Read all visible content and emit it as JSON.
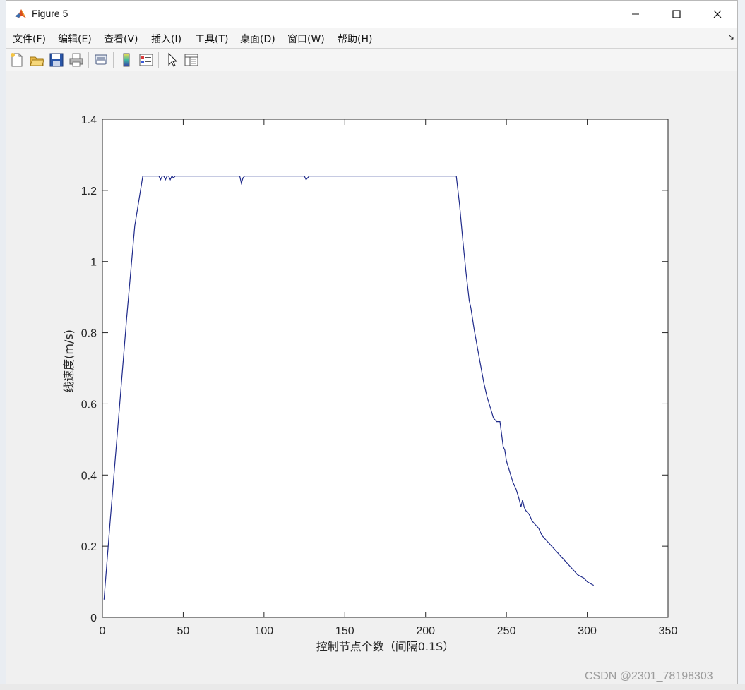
{
  "window": {
    "title": "Figure 5",
    "min_symbol": "—",
    "max_symbol": "☐",
    "close_symbol": "✕"
  },
  "menu": {
    "items": [
      "文件(F)",
      "编辑(E)",
      "查看(V)",
      "插入(I)",
      "工具(T)",
      "桌面(D)",
      "窗口(W)",
      "帮助(H)"
    ],
    "dock_arrow": "↘"
  },
  "toolbar": {
    "icons": [
      "new-figure-icon",
      "open-file-icon",
      "save-icon",
      "print-icon",
      "print-preview-icon",
      "colorbar-icon",
      "legend-icon",
      "pointer-icon",
      "property-editor-icon"
    ]
  },
  "watermark": "CSDN @2301_78198303",
  "colors": {
    "line": "#1f2a8a",
    "axes_bg": "#ffffff",
    "figure_bg": "#f0f0f0"
  },
  "chart_data": {
    "type": "line",
    "xlabel": "控制节点个数（间隔0.1S）",
    "ylabel": "线速度(m/s)",
    "xlim": [
      0,
      350
    ],
    "ylim": [
      0,
      1.4
    ],
    "xticks": [
      0,
      50,
      100,
      150,
      200,
      250,
      300,
      350
    ],
    "yticks": [
      0,
      0.2,
      0.4,
      0.6,
      0.8,
      1,
      1.2,
      1.4
    ],
    "xtick_labels": [
      "0",
      "50",
      "100",
      "150",
      "200",
      "250",
      "300",
      "350"
    ],
    "ytick_labels": [
      "0",
      "0.2",
      "0.4",
      "0.6",
      "0.8",
      "1",
      "1.2",
      "1.4"
    ],
    "grid": false,
    "series": [
      {
        "x": [
          1,
          5,
          10,
          15,
          20,
          25,
          35,
          36,
          37,
          38,
          39,
          40,
          41,
          42,
          43,
          44,
          45,
          85,
          86,
          87,
          88,
          125,
          126,
          127,
          128,
          219,
          221,
          223,
          225,
          227,
          228,
          230,
          232,
          234,
          236,
          238,
          240,
          242,
          244,
          246,
          248,
          249,
          250,
          252,
          254,
          256,
          258,
          259,
          260,
          261,
          262,
          264,
          266,
          268,
          270,
          272,
          274,
          276,
          278,
          280,
          282,
          284,
          286,
          288,
          290,
          292,
          294,
          296,
          298,
          300,
          302,
          304
        ],
        "y": [
          0.05,
          0.28,
          0.56,
          0.84,
          1.1,
          1.24,
          1.24,
          1.23,
          1.24,
          1.24,
          1.23,
          1.24,
          1.24,
          1.23,
          1.24,
          1.235,
          1.24,
          1.24,
          1.22,
          1.235,
          1.24,
          1.24,
          1.23,
          1.235,
          1.24,
          1.24,
          1.16,
          1.06,
          0.97,
          0.89,
          0.87,
          0.81,
          0.76,
          0.71,
          0.66,
          0.62,
          0.59,
          0.56,
          0.55,
          0.55,
          0.48,
          0.47,
          0.44,
          0.41,
          0.38,
          0.36,
          0.33,
          0.31,
          0.33,
          0.31,
          0.3,
          0.29,
          0.27,
          0.26,
          0.25,
          0.23,
          0.22,
          0.21,
          0.2,
          0.19,
          0.18,
          0.17,
          0.16,
          0.15,
          0.14,
          0.13,
          0.12,
          0.115,
          0.11,
          0.1,
          0.095,
          0.09
        ]
      }
    ]
  }
}
